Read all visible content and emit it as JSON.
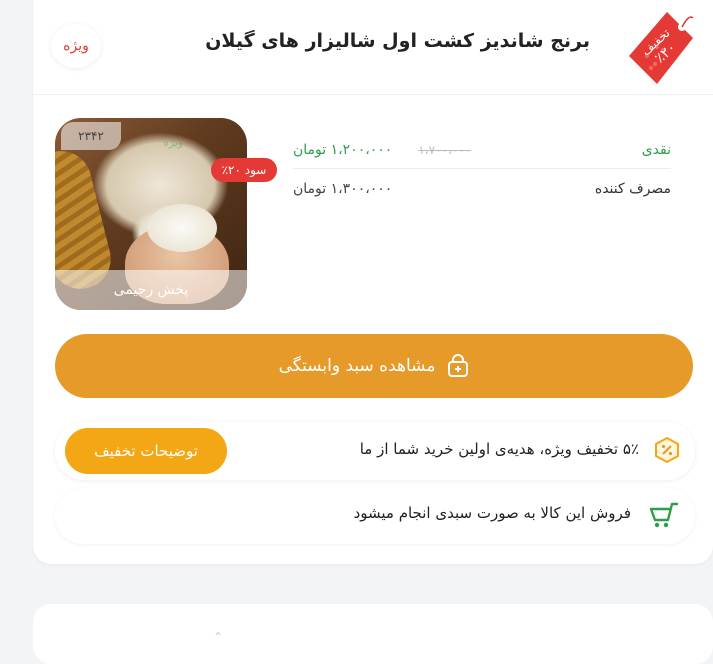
{
  "header": {
    "discount_tag_line1": "تخفیف",
    "discount_tag_line2": "٪۲۰",
    "title": "برنج شاندیز کشت اول شالیزار های گیلان",
    "special_badge": "ویژه"
  },
  "product_image": {
    "code": "۲۳۴۲",
    "watermark": "ویژه",
    "footer_text": "پخش رحیمی",
    "profit_badge": "٪۲۰ سود"
  },
  "prices": {
    "cash": {
      "label": "نقدی",
      "old_price": "۱،۷۰۰،۰۰۰",
      "new_price": "۱،۲۰۰،۰۰۰ تومان"
    },
    "consumer": {
      "label": "مصرف کننده",
      "price": "۱،۳۰۰،۰۰۰ تومان"
    }
  },
  "cta": {
    "label": "مشاهده سبد وابستگی",
    "icon": "shopping-bag-plus-icon"
  },
  "first_purchase": {
    "text": "۵٪ تخفیف ویژه، هدیه‌ی اولین خرید شما از ما",
    "button_label": "توضیحات تخفیف",
    "icon": "percent-badge-icon"
  },
  "basket_sale": {
    "text": "فروش این کالا به صورت سبدی انجام میشود",
    "icon": "cart-icon"
  },
  "colors": {
    "accent_orange": "#e69a2a",
    "button_yellow": "#f4a714",
    "red": "#e53935",
    "green": "#2e9e4a"
  }
}
